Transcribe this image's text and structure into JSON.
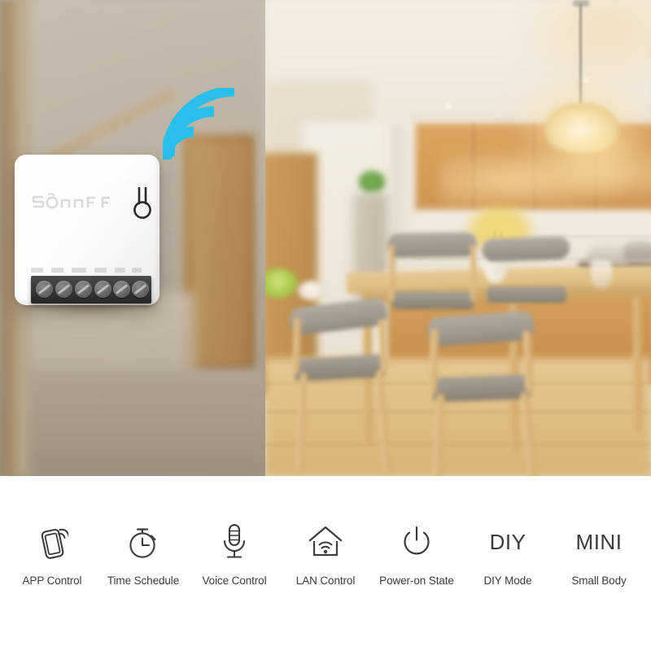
{
  "product": {
    "brand": "SONOFF",
    "device_name": "SONOFF MINI smart switch",
    "body_icon": "light-bulb-icon",
    "terminal_count": 6,
    "wifi_indicator": "wifi-waves-icon",
    "wifi_color": "#2ABFEA"
  },
  "scene": {
    "left": {
      "name": "hallway-staircase",
      "description": "Blurred indoor hallway with wooden staircase railing and wood door"
    },
    "right": {
      "name": "kitchen-dining",
      "description": "Blurred warm kitchen with pendant lamp, wooden cabinets, dining table and chairs"
    }
  },
  "features": [
    {
      "icon": "smartphone-wifi-icon",
      "icon_text": "",
      "label": "APP Control"
    },
    {
      "icon": "stopwatch-icon",
      "icon_text": "",
      "label": "Time Schedule"
    },
    {
      "icon": "microphone-icon",
      "icon_text": "",
      "label": "Voice Control"
    },
    {
      "icon": "house-wifi-icon",
      "icon_text": "",
      "label": "LAN Control"
    },
    {
      "icon": "power-icon",
      "icon_text": "",
      "label": "Power-on State"
    },
    {
      "icon": "diy-text-icon",
      "icon_text": "DIY",
      "label": "DIY Mode"
    },
    {
      "icon": "mini-text-icon",
      "icon_text": "MINI",
      "label": "Small Body"
    }
  ],
  "colors": {
    "accent_cyan": "#2ABFEA",
    "label_gray": "#3B3B3B",
    "icon_stroke": "#3C3C3C",
    "background": "#FFFFFF"
  }
}
